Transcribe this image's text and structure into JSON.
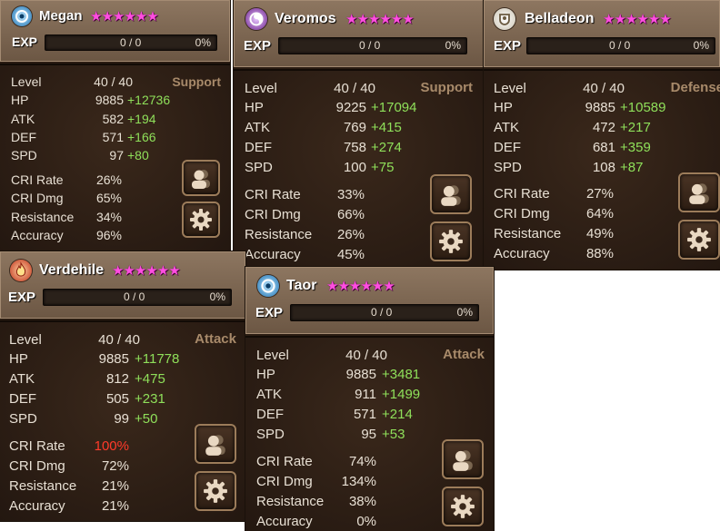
{
  "exp_label": "EXP",
  "stat_labels": {
    "level": "Level",
    "hp": "HP",
    "atk": "ATK",
    "def": "DEF",
    "spd": "SPD",
    "cri_rate": "CRI Rate",
    "cri_dmg": "CRI Dmg",
    "resistance": "Resistance",
    "accuracy": "Accuracy"
  },
  "colors": {
    "bonus": "#8fe05a",
    "stars": "#ff4ee0",
    "role": "#a88a6a",
    "highlight": "#ff3a2a"
  },
  "monsters": [
    {
      "name": "Megan",
      "element_icon": "water-element-icon",
      "stars": "★★★★★★",
      "exp": "0 / 0",
      "exp_pct": "0%",
      "role": "Support",
      "level": "40 / 40",
      "hp": "9885",
      "hp_bonus": "+12736",
      "atk": "582",
      "atk_bonus": "+194",
      "def": "571",
      "def_bonus": "+166",
      "spd": "97",
      "spd_bonus": "+80",
      "cri_rate": "26%",
      "cri_dmg": "65%",
      "resistance": "34%",
      "accuracy": "96%"
    },
    {
      "name": "Veromos",
      "element_icon": "dark-element-icon",
      "stars": "★★★★★★",
      "exp": "0 / 0",
      "exp_pct": "0%",
      "role": "Support",
      "level": "40 / 40",
      "hp": "9225",
      "hp_bonus": "+17094",
      "atk": "769",
      "atk_bonus": "+415",
      "def": "758",
      "def_bonus": "+274",
      "spd": "100",
      "spd_bonus": "+75",
      "cri_rate": "33%",
      "cri_dmg": "66%",
      "resistance": "26%",
      "accuracy": "45%"
    },
    {
      "name": "Belladeon",
      "element_icon": "light-element-icon",
      "stars": "★★★★★★",
      "exp": "0 / 0",
      "exp_pct": "0%",
      "role": "Defense",
      "level": "40 / 40",
      "hp": "9885",
      "hp_bonus": "+10589",
      "atk": "472",
      "atk_bonus": "+217",
      "def": "681",
      "def_bonus": "+359",
      "spd": "108",
      "spd_bonus": "+87",
      "cri_rate": "27%",
      "cri_dmg": "64%",
      "resistance": "49%",
      "accuracy": "88%"
    },
    {
      "name": "Verdehile",
      "element_icon": "fire-element-icon",
      "stars": "★★★★★★",
      "exp": "0 / 0",
      "exp_pct": "0%",
      "role": "Attack",
      "level": "40 / 40",
      "hp": "9885",
      "hp_bonus": "+11778",
      "atk": "812",
      "atk_bonus": "+475",
      "def": "505",
      "def_bonus": "+231",
      "spd": "99",
      "spd_bonus": "+50",
      "cri_rate": "100%",
      "cri_dmg": "72%",
      "resistance": "21%",
      "accuracy": "21%"
    },
    {
      "name": "Taor",
      "element_icon": "water-element-icon",
      "stars": "★★★★★★",
      "exp": "0 / 0",
      "exp_pct": "0%",
      "role": "Attack",
      "level": "40 / 40",
      "hp": "9885",
      "hp_bonus": "+3481",
      "atk": "911",
      "atk_bonus": "+1499",
      "def": "571",
      "def_bonus": "+214",
      "spd": "95",
      "spd_bonus": "+53",
      "cri_rate": "74%",
      "cri_dmg": "134%",
      "resistance": "38%",
      "accuracy": "0%"
    }
  ]
}
